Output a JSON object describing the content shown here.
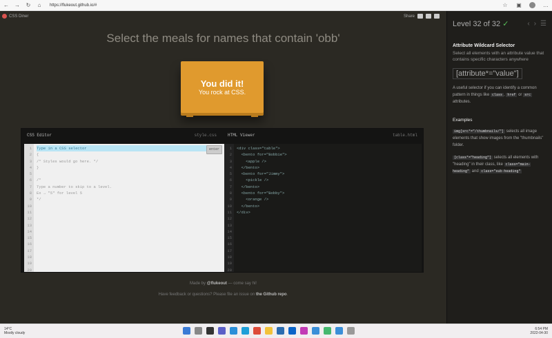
{
  "browser": {
    "url": "https://flukeout.github.io/#"
  },
  "header": {
    "logo": "CSS Diner",
    "share": "Share"
  },
  "instruction": "Select the meals for names that contain 'obb'",
  "plate": {
    "line1": "You did it!",
    "line2": "You rock at CSS."
  },
  "editor": {
    "left_title": "CSS Editor",
    "left_file": "style.css",
    "right_title": "HTML Viewer",
    "right_file": "table.html",
    "enter_label": "enter",
    "css_lines": [
      "Type in a CSS selector",
      "{",
      "/* Styles would go here. */",
      "}",
      "",
      "/*",
      "Type a number to skip to a level.",
      "Ex → \"5\" for level 5",
      "*/"
    ],
    "html_lines": [
      "<div class=\"table\">",
      "  <bento for=\"Bobbie\">",
      "    <apple />",
      "  </bento>",
      "  <bento for=\"Jimmy\">",
      "    <pickle />",
      "  </bento>",
      "  <bento for=\"Bobby\">",
      "    <orange />",
      "  </bento>",
      "</div>"
    ],
    "line_count": 20
  },
  "footer": {
    "made_prefix": "Made by ",
    "made_handle": "@flukeout",
    "made_suffix": " — come say hi!",
    "feedback_prefix": "Have feedback or questions? Please file an issue on ",
    "feedback_link": "the Github repo",
    "feedback_suffix": "."
  },
  "sidebar": {
    "level_label": "Level 32 of 32",
    "check": "✓",
    "heading": "Attribute Wildcard Selector",
    "desc": "Select all elements with an attribute value that contains specific characters anywhere",
    "syntax": "[attribute*=\"value\"]",
    "useful_prefix": "A useful selector if you can identify a common pattern in things like ",
    "useful_code1": "class",
    "useful_code2": "href",
    "useful_code3": "src",
    "useful_or": " or ",
    "useful_suffix": " attributes.",
    "examples_title": "Examples",
    "ex1_code": "img[src*=\"/thumbnails/\"]",
    "ex1_text": " selects all image elements that show images from the \"thumbnails\" folder.",
    "ex2_code": "[class*=\"heading\"]",
    "ex2_text": " selects all elements with \"heading\" in their class, like ",
    "ex2_code2": "class=\"main-heading\"",
    "ex2_and": " and ",
    "ex2_code3": "class=\"sub-heading\""
  },
  "taskbar": {
    "temp": "14°C",
    "weather": "Mostly cloudy",
    "time": "6:54 PM",
    "date": "2022-04-30"
  }
}
